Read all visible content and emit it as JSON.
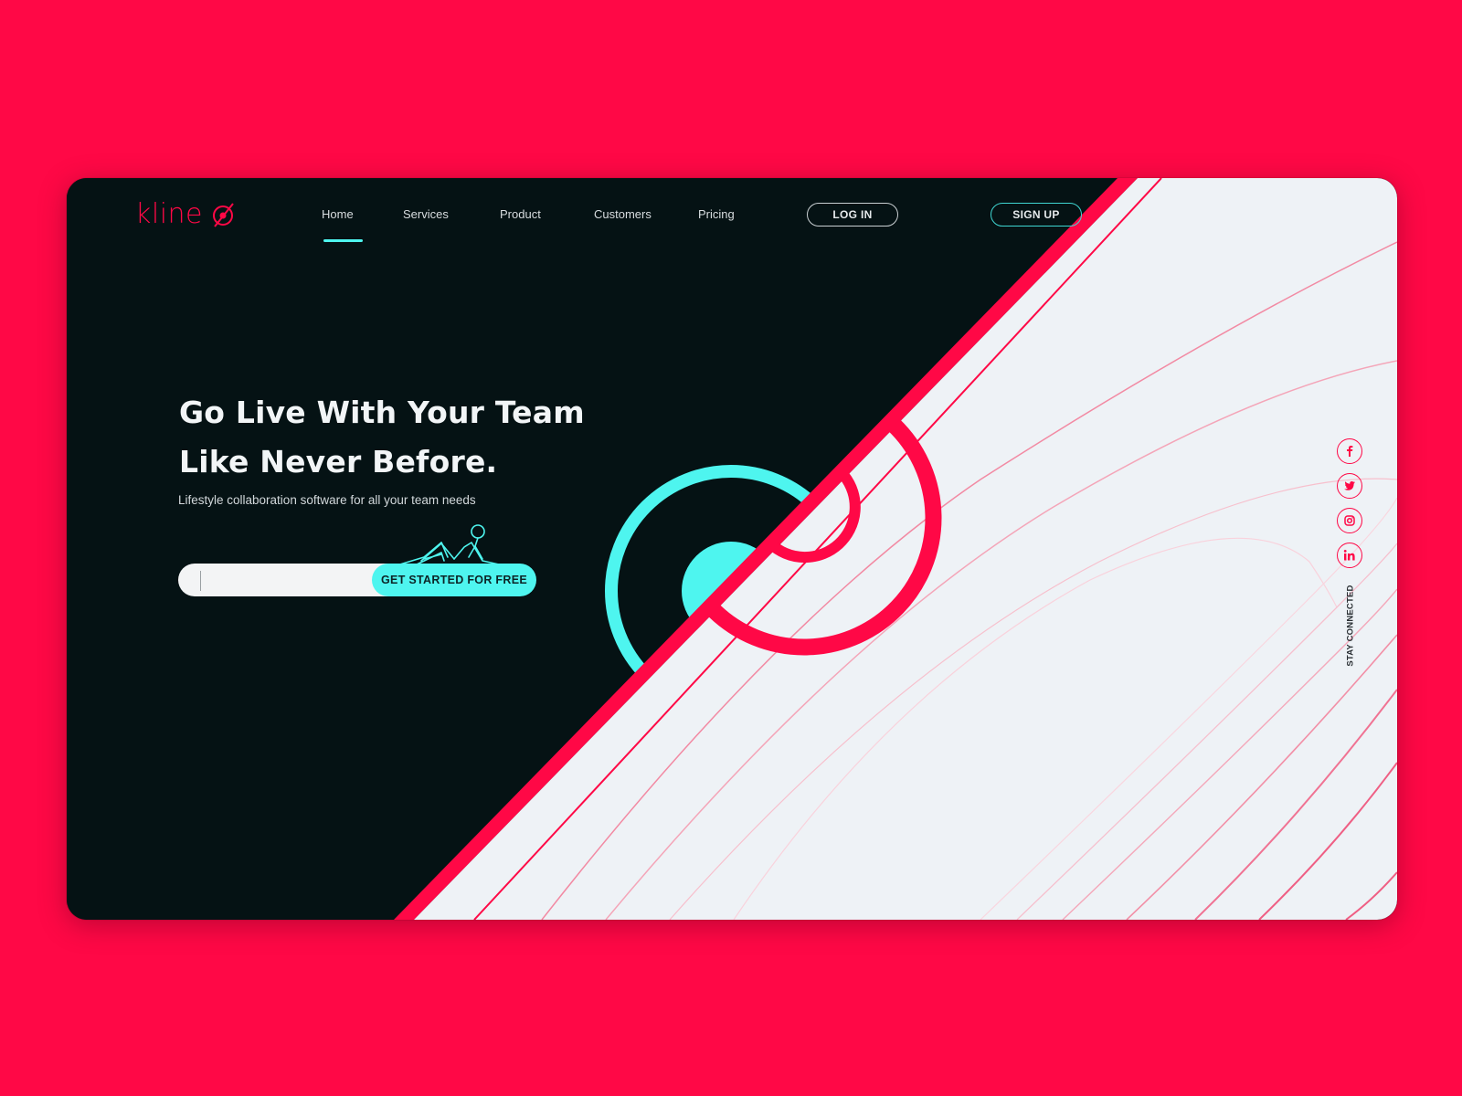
{
  "colors": {
    "background": "#ff0846",
    "dark": "#051214",
    "light": "#eef2f6",
    "accent_pink": "#ff0846",
    "accent_cyan": "#4ef5ef"
  },
  "header": {
    "logo_text": "kline",
    "logo_icon": "target-slash-icon",
    "nav": [
      {
        "label": "Home",
        "active": true
      },
      {
        "label": "Services",
        "active": false
      },
      {
        "label": "Product",
        "active": false
      },
      {
        "label": "Customers",
        "active": false
      },
      {
        "label": "Pricing",
        "active": false
      }
    ],
    "login_label": "LOG IN",
    "signup_label": "SIGN UP"
  },
  "hero": {
    "title_line1": "Go Live With Your Team",
    "title_line2": "Like Never Before.",
    "subtitle": "Lifestyle collaboration software for all your team needs",
    "email_value": "",
    "email_placeholder": "",
    "cta_label": "GET STARTED FOR FREE",
    "illustration": "reclining-person-illustration"
  },
  "social": {
    "items": [
      {
        "name": "facebook",
        "icon": "facebook-icon",
        "glyph": "f"
      },
      {
        "name": "twitter",
        "icon": "twitter-icon",
        "glyph": "t"
      },
      {
        "name": "instagram",
        "icon": "instagram-icon",
        "glyph": "ig"
      },
      {
        "name": "linkedin",
        "icon": "linkedin-icon",
        "glyph": "in"
      }
    ],
    "label": "STAY CONNECTED"
  }
}
